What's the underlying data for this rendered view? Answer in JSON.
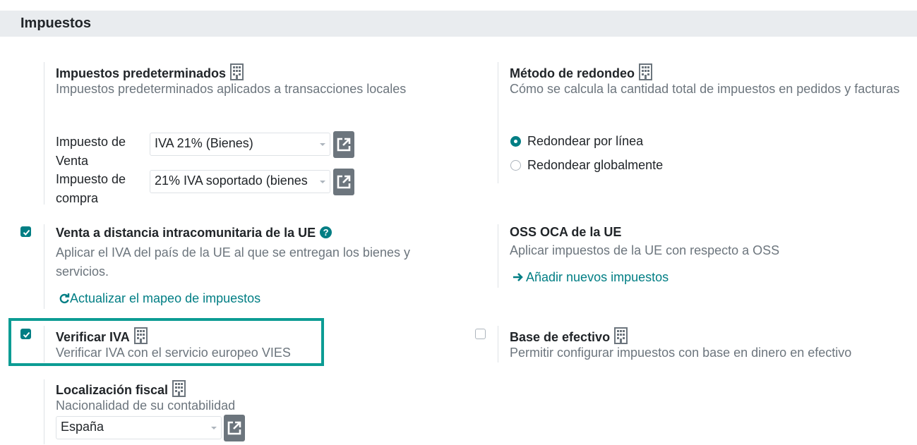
{
  "section": {
    "title": "Impuestos"
  },
  "colors": {
    "accent": "#017e84",
    "highlight": "#0c9c94",
    "header_bg": "#e9ecef"
  },
  "default_taxes": {
    "title": "Impuestos predeterminados",
    "icon": "building-icon",
    "description": "Impuestos predeterminados aplicados a transacciones locales",
    "sale_tax_label": "Impuesto de Venta",
    "sale_tax_value": "IVA 21% (Bienes)",
    "purchase_tax_label": "Impuesto de compra",
    "purchase_tax_value": "21% IVA soportado (bienes"
  },
  "rounding": {
    "title": "Método de redondeo",
    "icon": "building-icon",
    "description": "Cómo se calcula la cantidad total de impuestos en pedidos y facturas",
    "options": [
      {
        "label": "Redondear por línea",
        "selected": true
      },
      {
        "label": "Redondear globalmente",
        "selected": false
      }
    ]
  },
  "eu_distance_sales": {
    "checked": true,
    "title": "Venta a distancia intracomunitaria de la UE",
    "help_icon": "question-circle-icon",
    "description": "Aplicar el IVA del país de la UE al que se entregan los bienes y servicios.",
    "action_label": "Actualizar el mapeo de impuestos",
    "action_icon": "refresh-icon"
  },
  "oss": {
    "title": "OSS OCA de la UE",
    "description": "Aplicar impuestos de la UE con respecto a OSS",
    "action_label": "Añadir nuevos impuestos",
    "action_icon": "arrow-right-icon"
  },
  "vat_check": {
    "checked": true,
    "title": "Verificar IVA",
    "icon": "building-icon",
    "description": "Verificar IVA con el servicio europeo VIES"
  },
  "cash_basis": {
    "checked": false,
    "title": "Base de efectivo",
    "icon": "building-icon",
    "description": "Permitir configurar impuestos con base en dinero en efectivo"
  },
  "fiscal_localization": {
    "title": "Localización fiscal",
    "icon": "building-icon",
    "description": "Nacionalidad de su contabilidad",
    "value": "España"
  }
}
